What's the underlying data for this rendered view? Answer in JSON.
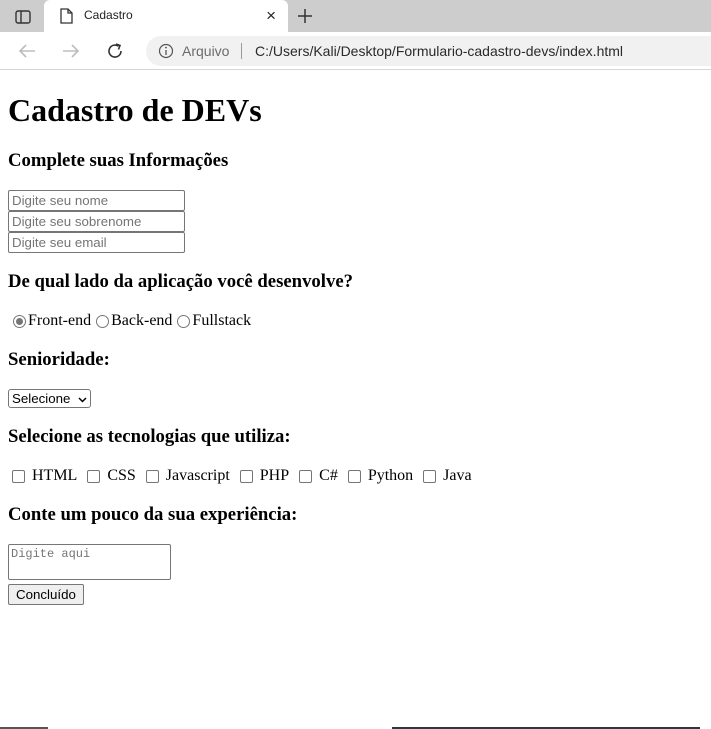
{
  "browser": {
    "tab_title": "Cadastro",
    "close_glyph": "×",
    "address_security_label": "Arquivo",
    "address_url": "C:/Users/Kali/Desktop/Formulario-cadastro-devs/index.html",
    "icons": [
      "sidebar-icon",
      "page-icon",
      "close-icon",
      "plus-icon",
      "back-icon",
      "forward-icon",
      "reload-icon",
      "info-icon"
    ]
  },
  "page": {
    "title": "Cadastro de DEVs",
    "info_heading": "Complete suas Informações",
    "fields": {
      "name_placeholder": "Digite seu nome",
      "surname_placeholder": "Digite seu sobrenome",
      "email_placeholder": "Digite seu email"
    },
    "side_heading": "De qual lado da aplicação você desenvolve?",
    "side_options": [
      {
        "label": "Front-end",
        "checked": true
      },
      {
        "label": "Back-end",
        "checked": false
      },
      {
        "label": "Fullstack",
        "checked": false
      }
    ],
    "seniority_heading": "Senioridade:",
    "seniority_selected": "Selecione",
    "tech_heading": "Selecione as tecnologias que utiliza:",
    "tech_options": [
      "HTML",
      "CSS",
      "Javascript",
      "PHP",
      "C#",
      "Python",
      "Java"
    ],
    "experience_heading": "Conte um pouco da sua experiência:",
    "experience_placeholder": "Digite aqui",
    "submit_label": "Concluído"
  }
}
